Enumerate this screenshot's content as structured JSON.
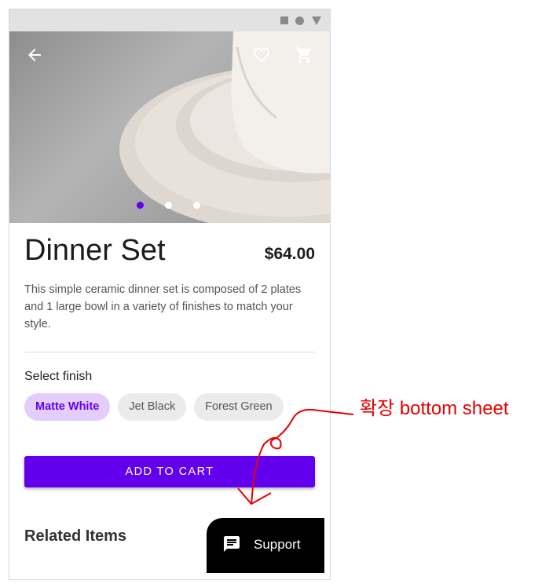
{
  "product": {
    "title": "Dinner Set",
    "price": "$64.00",
    "description": "This simple ceramic dinner set is composed of 2 plates and 1 large bowl in a variety of finishes to match your style."
  },
  "hero": {
    "icons": [
      "arrow-back-icon",
      "heart-outline-icon",
      "shopping-cart-icon"
    ],
    "carousel": {
      "count": 3,
      "active_index": 0
    }
  },
  "finish": {
    "label": "Select finish",
    "options": [
      "Matte White",
      "Jet Black",
      "Forest Green"
    ],
    "selected": "Matte White"
  },
  "actions": {
    "add_to_cart": "ADD TO CART"
  },
  "related": {
    "title": "Related Items"
  },
  "support": {
    "label": "Support",
    "icon": "chat-message-icon"
  },
  "annotation": {
    "text": "확장 bottom sheet",
    "color": "#e80000"
  },
  "colors": {
    "accent": "#6200ee",
    "chip_selected_bg": "#e3cdfb",
    "support_bg": "#000000"
  }
}
